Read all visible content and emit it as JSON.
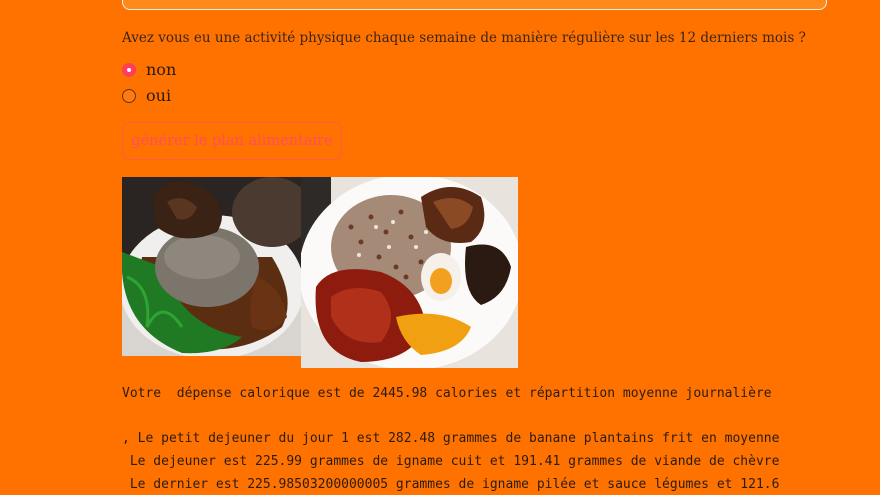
{
  "form": {
    "question": "Avez vous eu une activité physique chaque semaine de manière régulière sur les 12 derniers mois ?",
    "options": [
      {
        "label": "non",
        "selected": true
      },
      {
        "label": "oui",
        "selected": false
      }
    ],
    "generate_button": "générer le plan alimentaire"
  },
  "images": [
    {
      "icon": "food-plate-amala-ewedu-icon"
    },
    {
      "icon": "food-plate-rice-stew-fish-icon"
    }
  ],
  "output": {
    "line1": "Votre  dépense calorique est de 2445.98 calories et répartition moyenne journalière",
    "line2": ", Le petit dejeuner du jour 1 est 282.48 grammes de banane plantains frit en moyenne",
    "line3": " Le dejeuner est 225.99 grammes de igname cuit et 191.41 grammes de viande de chèvre",
    "line4": " Le dernier est 225.98503200000005 grammes de igname pilée et sauce légumes et 121.6"
  },
  "colors": {
    "background": "#ff7200",
    "accent": "#ff3d5c",
    "button_text": "#ff4d5e"
  }
}
